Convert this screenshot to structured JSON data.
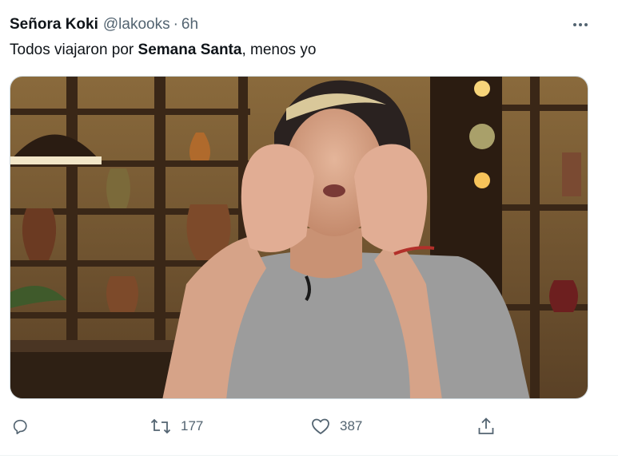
{
  "tweet": {
    "author_name": "Señora Koki",
    "handle": "@lakooks",
    "separator": "·",
    "time": "6h",
    "text_before": "Todos viajaron por ",
    "text_bold": "Semana Santa",
    "text_after": ", menos yo",
    "more_icon": "more-horizontal-icon",
    "media_alt": "Photo"
  },
  "actions": {
    "reply": {
      "icon": "reply-icon",
      "count": ""
    },
    "retweet": {
      "icon": "retweet-icon",
      "count": "177"
    },
    "like": {
      "icon": "heart-icon",
      "count": "387"
    },
    "share": {
      "icon": "share-icon"
    }
  },
  "colors": {
    "text": "#0f1419",
    "muted": "#536471",
    "border": "#cfd9de"
  }
}
